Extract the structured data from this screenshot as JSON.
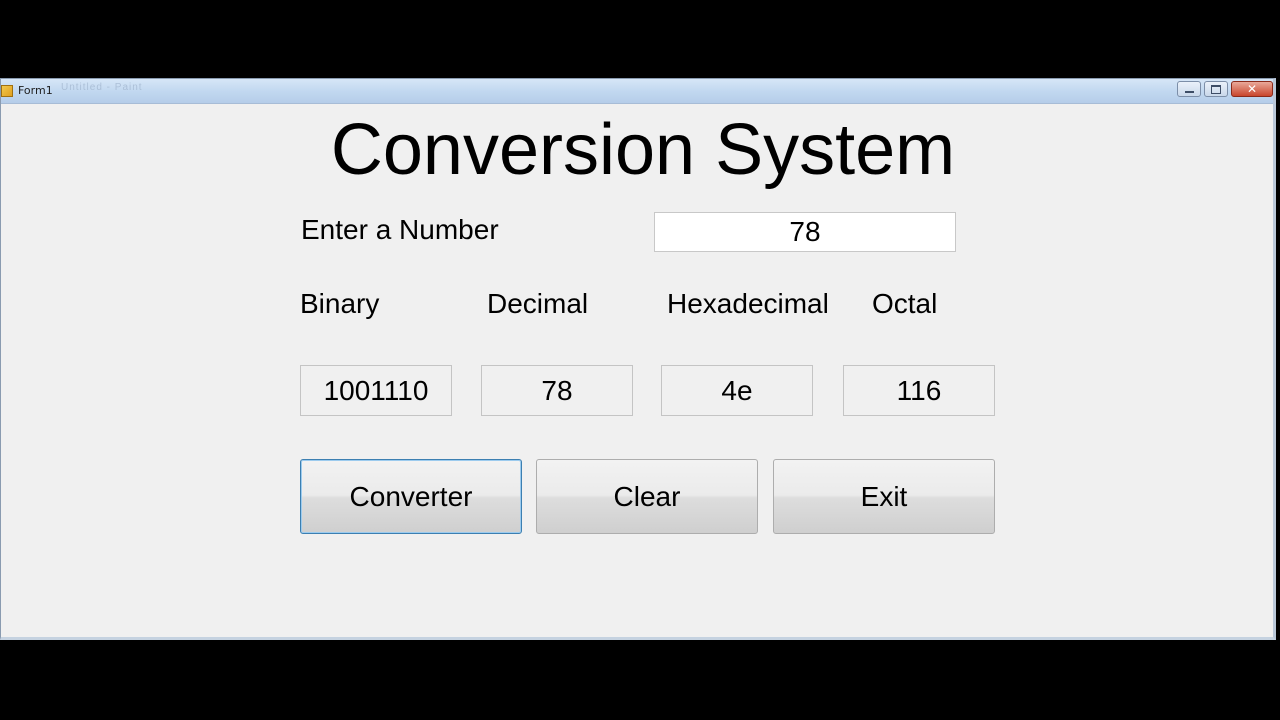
{
  "window": {
    "title": "Form1",
    "ghost_title": "Untitled - Paint",
    "controls": {
      "minimize_icon": "minimize-icon",
      "maximize_icon": "maximize-icon",
      "close_icon": "close-icon",
      "close_glyph": "✕"
    }
  },
  "main": {
    "heading": "Conversion System",
    "input_label": "Enter a Number",
    "input_value": "78",
    "columns": [
      {
        "label": "Binary",
        "value": "1001110"
      },
      {
        "label": "Decimal",
        "value": "78"
      },
      {
        "label": "Hexadecimal",
        "value": "4e"
      },
      {
        "label": "Octal",
        "value": "116"
      }
    ],
    "buttons": {
      "converter": "Converter",
      "clear": "Clear",
      "exit": "Exit"
    }
  },
  "colors": {
    "form_background": "#f0f0f0",
    "focus_border": "#3c7fb1",
    "close_button": "#c9452c"
  }
}
